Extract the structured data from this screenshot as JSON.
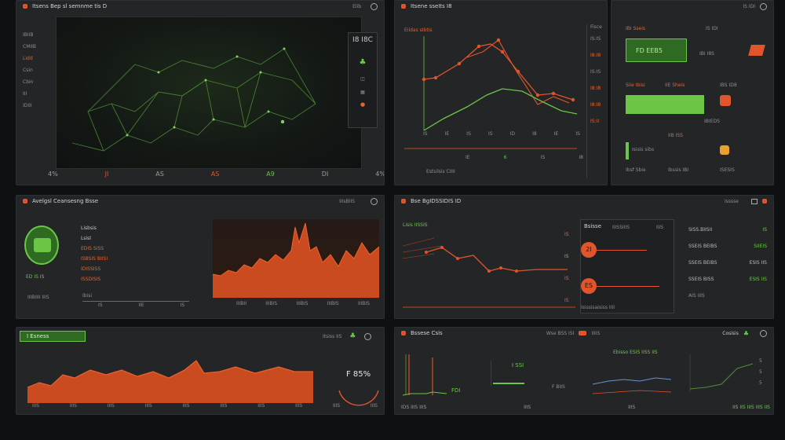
{
  "panel_map": {
    "title": "Itsens Bep sl semnme tis D",
    "top_right": "Elib",
    "stat_box": "I8 I8C",
    "side_labels": [
      "IBIIB",
      "CMIIB",
      "Lidd",
      "Csin",
      "Cbin",
      "III",
      "IDIII"
    ],
    "bottom_labels": [
      "4%",
      "JI",
      "AS",
      "AS",
      "A9",
      "DI",
      "4%"
    ]
  },
  "panel_line": {
    "title": "Itsene sseIts I8",
    "top_right": "IS IDI",
    "chart_label": "Eiidas sIbtis",
    "y_ticks": [
      "I8",
      "I8",
      "I8",
      "I8"
    ],
    "x_ticks": [
      "IS",
      "IE",
      "IS",
      "IS",
      "ID",
      "I8",
      "IE",
      "IS"
    ],
    "legend": [
      "IE",
      "6",
      "IS",
      "I8"
    ],
    "footer": "Estsilsis CIIII",
    "side_values": [
      "Fisce",
      "IS:IS",
      "I8:I8",
      "IS:IS",
      "I8:I8",
      "I8:I8",
      "IS:II"
    ]
  },
  "panel_stats": {
    "rows": [
      {
        "label": "IBI Sseis",
        "value": "IS IDI",
        "badge": "FD EEB5"
      },
      {
        "label": "Siie Ibisi",
        "value": "IBI I8S"
      },
      {
        "label": "IIE Sheis",
        "value": "IBS ID8"
      },
      {
        "label": "IIB ISS",
        "value": "IBIEDS"
      },
      {
        "label": "Isisis sibs",
        "value": "ISESIS"
      },
      {
        "label": "Ibsf Sbie",
        "value": "Ibssis IBI"
      }
    ]
  },
  "panel_gauge": {
    "title": "Avelgsl Ceansesng Bsse",
    "top_right": "IIIsBIIS",
    "items": [
      "Lisbsis",
      "Lsisl",
      "EDIS SISS",
      "ISBSIS BIISI",
      "IDISSISS",
      "ISSDISIS"
    ],
    "gauge_value": "ED IS IS",
    "footer_a": "IIIBIIII IIIS",
    "footer_b": "Ibisi",
    "ticks": [
      "IIIBII",
      "IIIBIS",
      "IIIBIS",
      "IIIBIS",
      "IIIBIS"
    ],
    "x_ticks": [
      "IS",
      "IIE",
      "IS",
      "IS",
      "IS",
      "I8"
    ]
  },
  "panel_trend": {
    "title": "Bse BgIDSSIDIS ID",
    "label": "Lisis IISSIS",
    "y_ticks": [
      "IS",
      "IS",
      "IS",
      "IS"
    ],
    "badges": [
      "2I",
      "ES"
    ],
    "side_title": "Bsisse",
    "side_sub": "IIBISS",
    "col_b": "IIISSIIIS",
    "col_c": "IIIS",
    "footer": "Isissisaisiss IIII",
    "right_rows": [
      {
        "label": "SISS.BIISII",
        "value": "IS"
      },
      {
        "label": "SSEIS BEIBS",
        "value": "SIIEIS"
      },
      {
        "label": "SSEIS BEIBS",
        "value": "ESIS IIS"
      },
      {
        "label": "SSEIS BISS",
        "value": "ESIS IIS"
      }
    ],
    "right_top": "Isssse",
    "right_footer": "AIS IIIS"
  },
  "panel_area": {
    "badge": "I Esness",
    "right_label": "Itsiss IIS",
    "percent": "F 85%",
    "x_ticks": [
      "IIIS",
      "IIIS",
      "IIIS",
      "IIIS",
      "IIIS",
      "IIIS",
      "IIIS",
      "IIIS",
      "IIIS",
      "IIIS"
    ]
  },
  "panel_small": {
    "title": "Bssese Csis",
    "header_mid": "Wse BSS ISI",
    "header_right": "IIIIS",
    "right_title": "Cosisis",
    "label_a": "I SSI",
    "label_b": "F BIIS",
    "label_c": "FDI",
    "footer_a": "IDS IIIS IIIS",
    "footer_b": "IIIS",
    "footer_mid": "IIIS",
    "footer_right": "IIS IIS IIIS IIIS IIS",
    "sub_label": "Ebisso ESIS IISS IIS",
    "right_ticks": [
      "5",
      "5",
      "5"
    ]
  },
  "colors": {
    "orange": "#e0552b",
    "green": "#6cc645",
    "panel": "#232527",
    "bg": "#0f1011"
  }
}
